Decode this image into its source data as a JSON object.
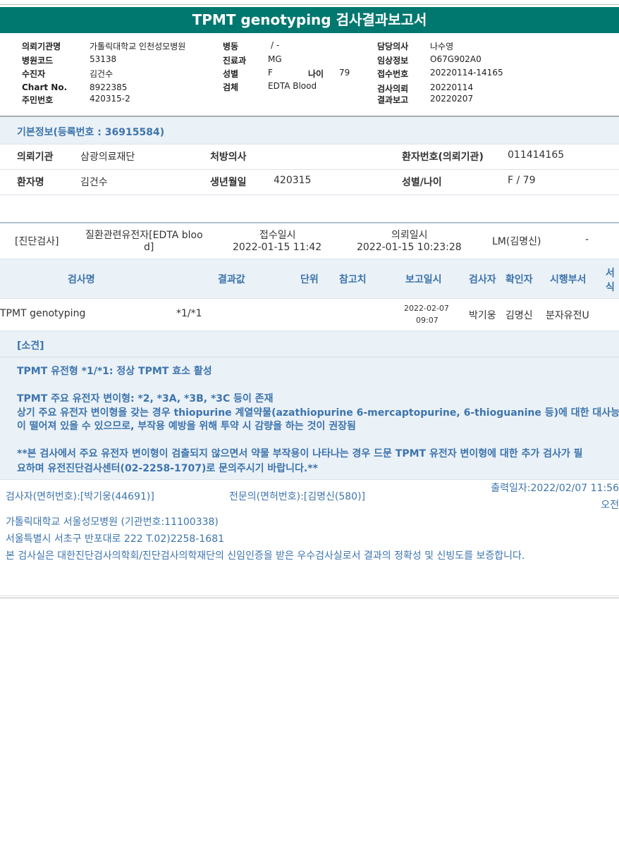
{
  "title": "TPMT genotyping 검사결과보고서",
  "header": {
    "col1": [
      {
        "label": "의뢰기관명",
        "value": "가톨릭대학교 인천성모병원"
      },
      {
        "label": "병원코드",
        "value": "53138"
      },
      {
        "label": "수진자",
        "value": "김건수"
      },
      {
        "label": "Chart No.",
        "value": "8922385"
      },
      {
        "label": "주민번호",
        "value": "420315-2"
      }
    ],
    "col2": [
      {
        "label": "병동",
        "value": "/ -"
      },
      {
        "label": "진료과",
        "value": "MG"
      },
      {
        "label": "성별",
        "value": "F"
      },
      {
        "label": "검체",
        "value": "EDTA Blood"
      }
    ],
    "age_label": "나이",
    "age_value": "79",
    "col3": [
      {
        "label": "담당의사",
        "value": "나수영"
      },
      {
        "label": "임상정보",
        "value": "O67G902A0"
      },
      {
        "label": "접수번호",
        "value": "20220114-14165"
      },
      {
        "label": "검사의뢰",
        "value": "20220114"
      },
      {
        "label": "결과보고",
        "value": "20220207"
      }
    ]
  },
  "basic": {
    "heading": "기본정보(등록번호 : 36915584)",
    "row1": {
      "l1": "의뢰기관",
      "v1": "삼광의료재단",
      "l2": "처방의사",
      "v2": "",
      "l3": "환자번호(의뢰기관)",
      "v3": "011414165"
    },
    "row2": {
      "l1": "환자명",
      "v1": "김건수",
      "l2": "생년월일",
      "v2": "420315",
      "l3": "성별/나이",
      "v3": "F / 79"
    }
  },
  "diag": {
    "type": "[진단검사]",
    "name_line1": "질환관련유전자[EDTA bloo",
    "name_line2": "d]",
    "recv_label": "접수일시",
    "recv_value": "2022-01-15  11:42",
    "req_label": "의뢰일시",
    "req_value": "2022-01-15  10:23:28",
    "person": "LM(김명신)",
    "dash": "-"
  },
  "table": {
    "headers": {
      "name": "검사명",
      "result": "결과값",
      "unit": "단위",
      "ref": "참고치",
      "date": "보고일시",
      "tester": "검사자",
      "confirm": "확인자",
      "dept": "시행부서",
      "form1": "서",
      "form2": "식"
    },
    "row": {
      "name": "TPMT genotyping",
      "result": "*1/*1",
      "unit": "",
      "ref": "",
      "date1": "2022-02-07",
      "date2": "09:07",
      "tester": "박기웅",
      "confirm": "김명신",
      "dept": "분자유전U"
    }
  },
  "opinion": {
    "heading": "[소견]",
    "lines": [
      "TPMT 유전형 *1/*1: 정상 TPMT 효소 활성",
      "TPMT 주요 유전자 변이형: *2, *3A, *3B, *3C 등이 존재",
      "상기 주요 유전자 변이형을 갖는 경우 thiopurine 계열약물(azathiopurine 6-mercaptopurine, 6-thioguanine 등)에 대한 대사능",
      "이 떨어져 있을 수 있으므로, 부작용 예방을 위해 투약 시 감량을 하는 것이 권장됨",
      "**본 검사에서 주요 유전자 변이형이 검출되지 않으면서 약물 부작용이 나타나는 경우 드문 TPMT 유전자 변이형에 대한 추가 검사가 필",
      "요하며 유전진단검사센터(02-2258-1707)로 문의주시기 바랍니다.**"
    ]
  },
  "footer": {
    "tester": "검사자(면허번호):[박기웅(44691)]",
    "specialist": "전문의(면허번호):[김명신(580)]",
    "printed": "출력일자:2022/02/07 11:56",
    "ampm": "오전",
    "hospital": "가톨릭대학교 서울성모병원 (기관번호:11100338)",
    "address": "서울특별시 서초구 반포대로 222 T.02)2258-1681",
    "cert": "본 검사실은 대한진단검사의학회/진단검사의학재단의 신임인증을 받은 우수검사실로서 결과의 정확성 및 신빙도를 보증합니다."
  },
  "colors": {
    "title_bg": "#00776f",
    "accent": "#3d74ad",
    "band": "#eaf1f7"
  }
}
